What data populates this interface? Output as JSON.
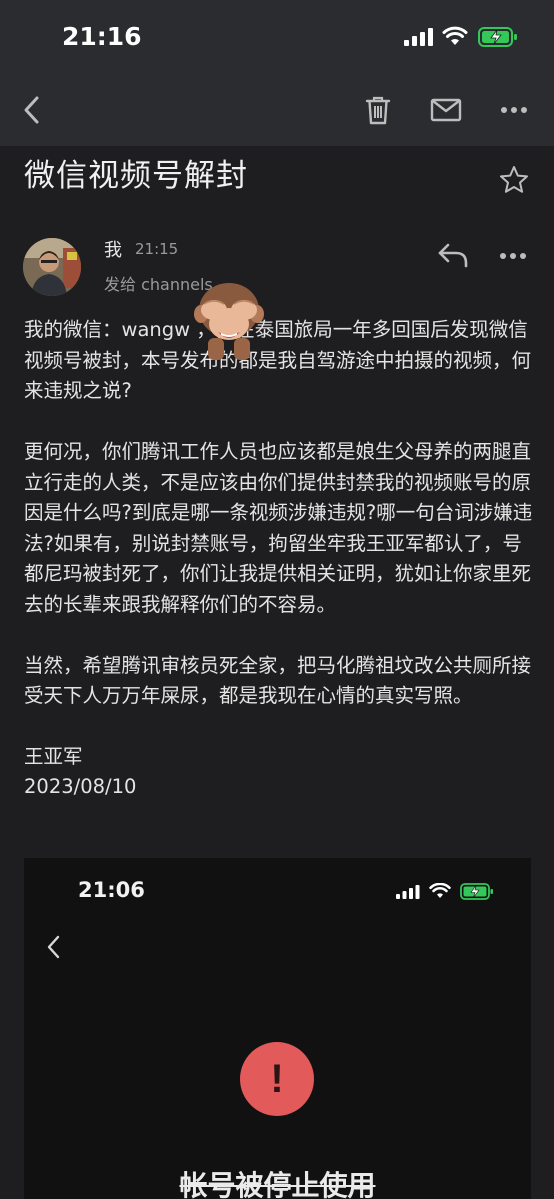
{
  "status_bar": {
    "time": "21:16"
  },
  "toolbar": {
    "back_icon": "chevron-left-icon",
    "delete_icon": "trash-icon",
    "mail_icon": "mail-icon",
    "more_icon": "more-horizontal-icon"
  },
  "email": {
    "subject": "微信视频号解封",
    "sender_name": "我",
    "time": "21:15",
    "recipient": "发给 channels ⌄",
    "paragraphs": [
      "我的微信：wangw           ，我在泰国旅局一年多回国后发现微信视频号被封，本号发布的都是我自驾游途中拍摄的视频，何来违规之说?",
      "更何况，你们腾讯工作人员也应该都是娘生父母养的两腿直立行走的人类，不是应该由你们提供封禁我的视频账号的原因是什么吗?到底是哪一条视频涉嫌违规?哪一句台词涉嫌违法?如果有，别说封禁账号，拘留坐牢我王亚军都认了，号都尼玛被封死了，你们让我提供相关证明，犹如让你家里死去的长辈来跟我解释你们的不容易。",
      "当然，希望腾讯审核员死全家，把马化腾祖坟改公共厕所接受天下人万万年屎尿，都是我现在心情的真实写照。"
    ],
    "signature_name": "王亚军",
    "signature_date": "2023/08/10"
  },
  "attachment": {
    "time": "21:06",
    "alert_symbol": "!",
    "title": "帐号被停止使用"
  },
  "colors": {
    "background": "#1e1e20",
    "bar": "#2b2c2f",
    "alert_red": "#e25a5a",
    "battery_green": "#34c759"
  }
}
